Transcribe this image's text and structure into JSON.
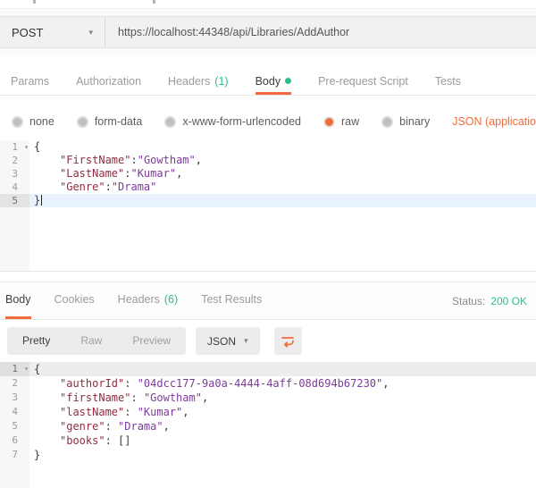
{
  "colors": {
    "accent_orange": "#f26b3a",
    "success_green": "#2cbe8e",
    "json_key": "#8f2c3f",
    "json_value": "#7d3a9b"
  },
  "request": {
    "method": "POST",
    "url": "https://localhost:44348/api/Libraries/AddAuthor"
  },
  "request_tabs": {
    "params": "Params",
    "authorization": "Authorization",
    "headers": "Headers",
    "headers_count": "(1)",
    "body": "Body",
    "pre_request": "Pre-request Script",
    "tests": "Tests",
    "active": "Body"
  },
  "body_type": {
    "none": "none",
    "form_data": "form-data",
    "urlencoded": "x-www-form-urlencoded",
    "raw": "raw",
    "binary": "binary",
    "selected": "raw",
    "content_type": "JSON (application/json"
  },
  "request_editor": {
    "lines": [
      {
        "num": "1",
        "tokens": [
          {
            "t": "{",
            "c": "p"
          }
        ]
      },
      {
        "num": "2",
        "tokens": [
          {
            "t": "\"FirstName\"",
            "c": "k"
          },
          {
            "t": ":",
            "c": "p"
          },
          {
            "t": "\"Gowtham\"",
            "c": "v"
          },
          {
            "t": ",",
            "c": "p"
          }
        ]
      },
      {
        "num": "3",
        "tokens": [
          {
            "t": "\"LastName\"",
            "c": "k"
          },
          {
            "t": ":",
            "c": "p"
          },
          {
            "t": "\"Kumar\"",
            "c": "v"
          },
          {
            "t": ",",
            "c": "p"
          }
        ]
      },
      {
        "num": "4",
        "tokens": [
          {
            "t": "\"Genre\"",
            "c": "k"
          },
          {
            "t": ":",
            "c": "p"
          },
          {
            "t": "\"Drama\"",
            "c": "v"
          }
        ]
      },
      {
        "num": "5",
        "tokens": [
          {
            "t": "}",
            "c": "p"
          }
        ]
      }
    ]
  },
  "response_tabs": {
    "body": "Body",
    "cookies": "Cookies",
    "headers": "Headers",
    "headers_count": "(6)",
    "test_results": "Test Results",
    "status_label": "Status:",
    "status_value": "200 OK",
    "active": "Body"
  },
  "response_toolbar": {
    "pretty": "Pretty",
    "raw": "Raw",
    "preview": "Preview",
    "active_view": "Pretty",
    "format": "JSON"
  },
  "response_editor": {
    "lines": [
      {
        "num": "1",
        "tokens": [
          {
            "t": "{",
            "c": "p"
          }
        ]
      },
      {
        "num": "2",
        "tokens": [
          {
            "t": "\"authorId\"",
            "c": "k"
          },
          {
            "t": ": ",
            "c": "p"
          },
          {
            "t": "\"04dcc177-9a0a-4444-4aff-08d694b67230\"",
            "c": "v"
          },
          {
            "t": ",",
            "c": "p"
          }
        ]
      },
      {
        "num": "3",
        "tokens": [
          {
            "t": "\"firstName\"",
            "c": "k"
          },
          {
            "t": ": ",
            "c": "p"
          },
          {
            "t": "\"Gowtham\"",
            "c": "v"
          },
          {
            "t": ",",
            "c": "p"
          }
        ]
      },
      {
        "num": "4",
        "tokens": [
          {
            "t": "\"lastName\"",
            "c": "k"
          },
          {
            "t": ": ",
            "c": "p"
          },
          {
            "t": "\"Kumar\"",
            "c": "v"
          },
          {
            "t": ",",
            "c": "p"
          }
        ]
      },
      {
        "num": "5",
        "tokens": [
          {
            "t": "\"genre\"",
            "c": "k"
          },
          {
            "t": ": ",
            "c": "p"
          },
          {
            "t": "\"Drama\"",
            "c": "v"
          },
          {
            "t": ",",
            "c": "p"
          }
        ]
      },
      {
        "num": "6",
        "tokens": [
          {
            "t": "\"books\"",
            "c": "k"
          },
          {
            "t": ": ",
            "c": "p"
          },
          {
            "t": "[]",
            "c": "p"
          }
        ]
      },
      {
        "num": "7",
        "tokens": [
          {
            "t": "}",
            "c": "p"
          }
        ]
      }
    ]
  }
}
